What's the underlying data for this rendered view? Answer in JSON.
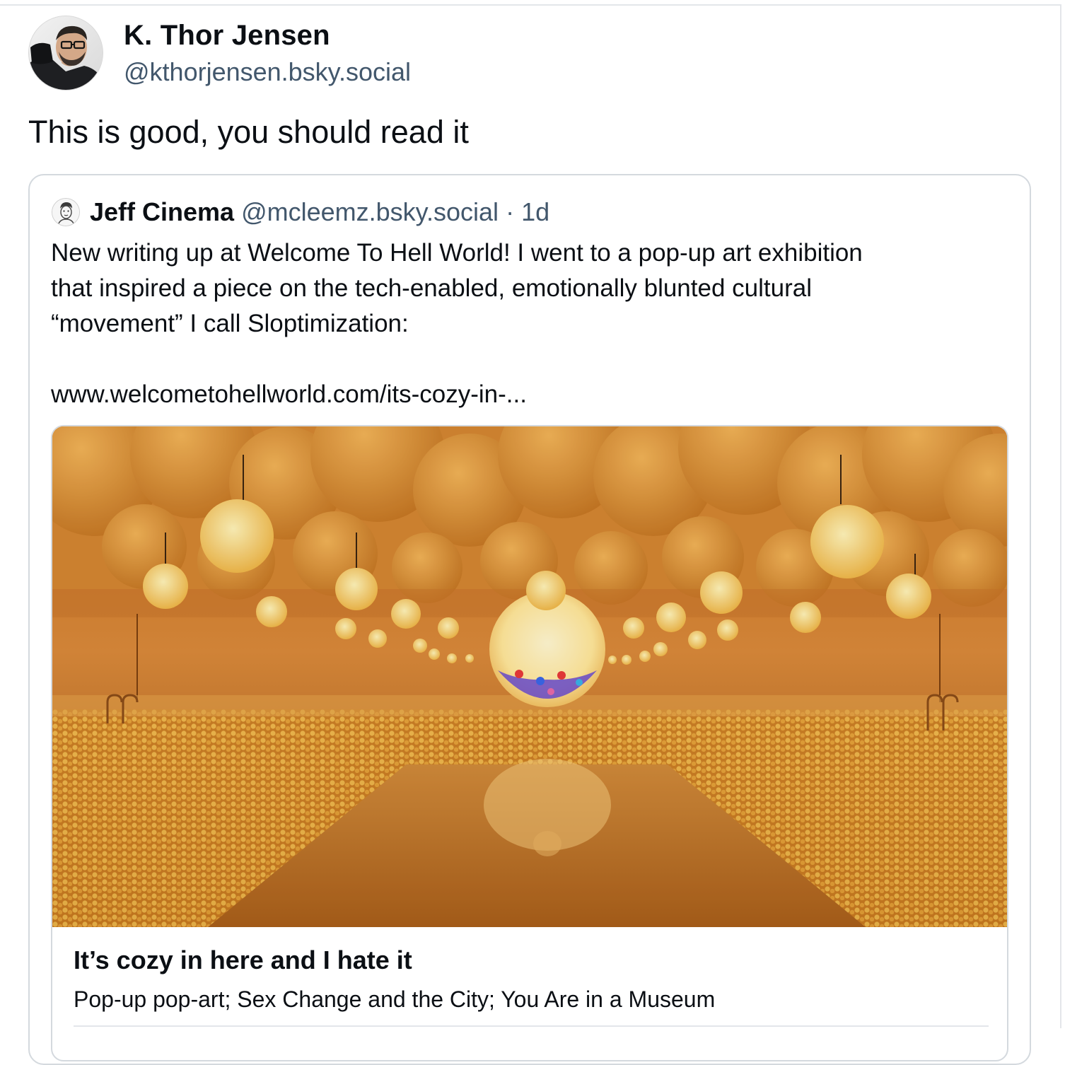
{
  "post": {
    "author_name": "K. Thor Jensen",
    "author_handle": "@kthorjensen.bsky.social",
    "text": "This is good, you should read it"
  },
  "quote": {
    "author_name": "Jeff Cinema",
    "author_handle": "@mcleemz.bsky.social",
    "separator": "·",
    "time": "1d",
    "lines": [
      "New writing up at Welcome To Hell World! I went to a pop-up art exhibition",
      "that inspired a piece on the tech-enabled, emotionally blunted cultural",
      "“movement” I call Sloptimization:"
    ],
    "link": "www.welcometohellworld.com/its-cozy-in-..."
  },
  "embed": {
    "title": "It’s cozy in here and I hate it",
    "description": "Pop-up pop-art; Sex Change and the City; You Are in a Museum"
  },
  "icons": {
    "author_avatar": "avatar-photo-icon",
    "quote_avatar": "avatar-sketch-icon"
  },
  "colors": {
    "text": "#0b0f14",
    "muted": "#42576c",
    "border": "#d4d9de",
    "image_warm": "#d98a2b"
  }
}
